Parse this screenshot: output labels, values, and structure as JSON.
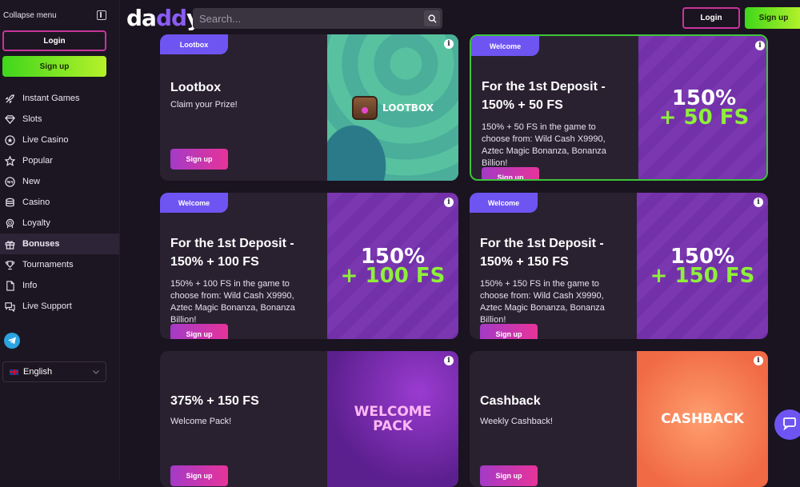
{
  "sidebar": {
    "collapse_label": "Collapse menu",
    "login_label": "Login",
    "signup_label": "Sign up",
    "items": [
      {
        "label": "Instant Games",
        "icon": "rocket-icon"
      },
      {
        "label": "Slots",
        "icon": "diamond-icon"
      },
      {
        "label": "Live Casino",
        "icon": "star-circle-icon"
      },
      {
        "label": "Popular",
        "icon": "star-icon"
      },
      {
        "label": "New",
        "icon": "new-badge-icon"
      },
      {
        "label": "Casino",
        "icon": "coins-icon"
      },
      {
        "label": "Loyalty",
        "icon": "medal-icon"
      },
      {
        "label": "Bonuses",
        "icon": "gift-icon"
      },
      {
        "label": "Tournaments",
        "icon": "trophy-icon"
      },
      {
        "label": "Info",
        "icon": "document-icon"
      },
      {
        "label": "Live Support",
        "icon": "chat-icon"
      }
    ],
    "active_item": "Bonuses",
    "language": "English"
  },
  "header": {
    "logo": "daddy",
    "search_placeholder": "Search...",
    "login_label": "Login",
    "signup_label": "Sign up"
  },
  "cards": [
    {
      "badge": "Lootbox",
      "title": "Lootbox",
      "subtitle": "Claim your Prize!",
      "description": "",
      "button": "Sign up",
      "image_label": "LOOTBOX"
    },
    {
      "badge": "Welcome",
      "title": "For the 1st Deposit - 150% + 50 FS",
      "subtitle": "",
      "description": "150% + 50 FS in the game to choose from: Wild Cash X9990, Aztec Magic Bonanza, Bonanza Billion!",
      "button": "Sign up",
      "promo_top": "150%",
      "promo_bottom": "+ 50 FS"
    },
    {
      "badge": "Welcome",
      "title": "For the 1st Deposit - 150% + 100 FS",
      "subtitle": "",
      "description": "150% + 100 FS in the game to choose from: Wild Cash X9990, Aztec Magic Bonanza, Bonanza Billion!",
      "button": "Sign up",
      "promo_top": "150%",
      "promo_bottom": "+ 100 FS"
    },
    {
      "badge": "Welcome",
      "title": "For the 1st Deposit - 150% + 150 FS",
      "subtitle": "",
      "description": "150% + 150 FS in the game to choose from: Wild Cash X9990, Aztec Magic Bonanza, Bonanza Billion!",
      "button": "Sign up",
      "promo_top": "150%",
      "promo_bottom": "+ 150 FS"
    },
    {
      "badge": "",
      "title": "375% + 150 FS",
      "subtitle": "Welcome Pack!",
      "description": "",
      "button": "Sign up",
      "image_label_top": "WELCOME",
      "image_label_bottom": "PACK"
    },
    {
      "badge": "",
      "title": "Cashback",
      "subtitle": "Weekly Cashback!",
      "description": "",
      "button": "Sign up",
      "image_label": "CASHBACK"
    }
  ],
  "info_glyph": "i",
  "colors": {
    "accent_green": "#8ef03a",
    "accent_pink": "#e6349a",
    "badge_purple": "#6e55f2",
    "background": "#1a1320"
  }
}
